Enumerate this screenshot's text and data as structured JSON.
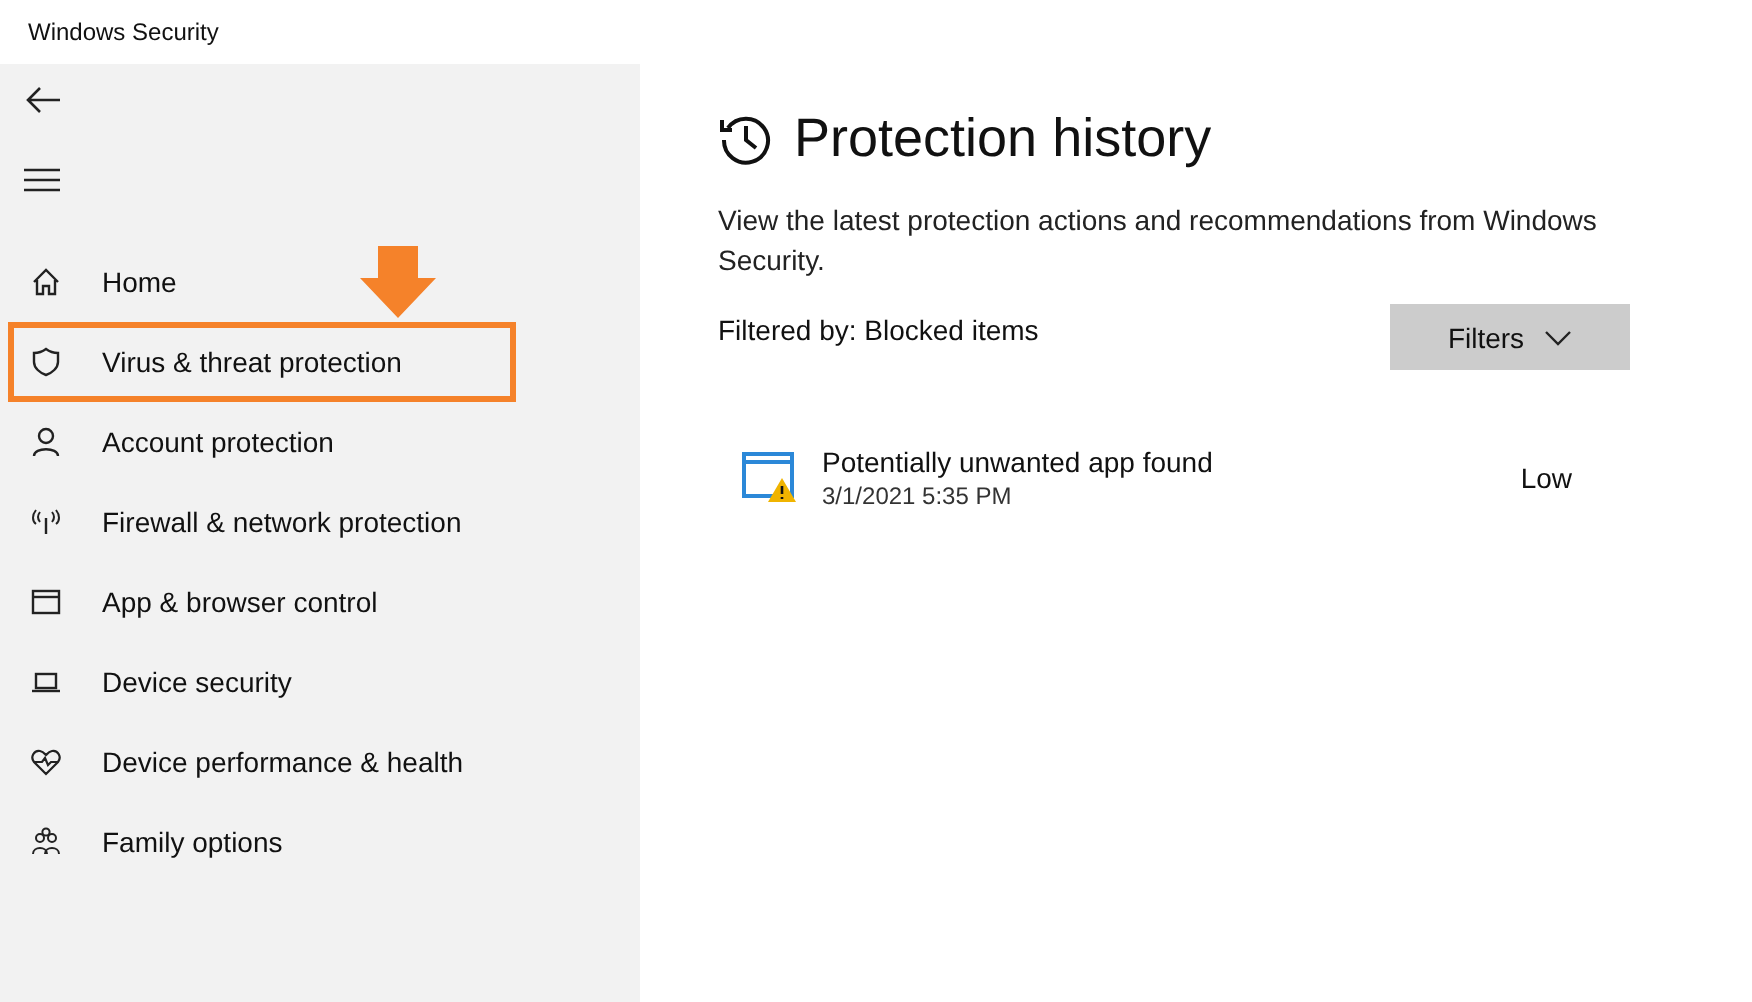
{
  "window": {
    "title": "Windows Security"
  },
  "sidebar": {
    "items": [
      {
        "label": "Home",
        "highlighted": false
      },
      {
        "label": "Virus & threat protection",
        "highlighted": true
      },
      {
        "label": "Account protection",
        "highlighted": false
      },
      {
        "label": "Firewall & network protection",
        "highlighted": false
      },
      {
        "label": "App & browser control",
        "highlighted": false
      },
      {
        "label": "Device security",
        "highlighted": false
      },
      {
        "label": "Device performance & health",
        "highlighted": false
      },
      {
        "label": "Family options",
        "highlighted": false
      }
    ]
  },
  "page": {
    "title": "Protection history",
    "description": "View the latest protection actions and recommendations from Windows Security.",
    "filter_label": "Filtered by: Blocked items",
    "filters_button": "Filters",
    "items": [
      {
        "title": "Potentially unwanted app found",
        "date": "3/1/2021 5:35 PM",
        "severity": "Low"
      }
    ]
  }
}
